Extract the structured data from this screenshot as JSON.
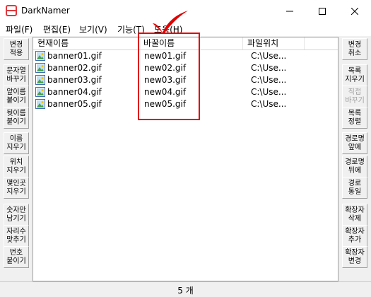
{
  "window": {
    "title": "DarkNamer"
  },
  "menu": [
    {
      "label": "파일(F)"
    },
    {
      "label": "편집(E)"
    },
    {
      "label": "보기(V)"
    },
    {
      "label": "기능(T)"
    },
    {
      "label": "도움(H)"
    }
  ],
  "list": {
    "columns": [
      "현재이름",
      "바꿀이름",
      "파일위치"
    ],
    "rows": [
      {
        "current": "banner01.gif",
        "new": "new01.gif",
        "location": "C:\\Use..."
      },
      {
        "current": "banner02.gif",
        "new": "new02.gif",
        "location": "C:\\Use..."
      },
      {
        "current": "banner03.gif",
        "new": "new03.gif",
        "location": "C:\\Use..."
      },
      {
        "current": "banner04.gif",
        "new": "new04.gif",
        "location": "C:\\Use..."
      },
      {
        "current": "banner05.gif",
        "new": "new05.gif",
        "location": "C:\\Use..."
      }
    ]
  },
  "left_toolbar": [
    {
      "label": "변경\n적용"
    },
    {
      "label": "문자열\n바꾸기"
    },
    {
      "label": "앞이름\n붙이기"
    },
    {
      "label": "뒷이름\n붙이기"
    },
    {
      "label": "이름\n지우기"
    },
    {
      "label": "위치\n지우기"
    },
    {
      "label": "몇인곳\n지우기"
    },
    {
      "label": "숫자만\n남기기"
    },
    {
      "label": "자리수\n맞추기"
    },
    {
      "label": "번호\n붙이기"
    }
  ],
  "right_toolbar": [
    {
      "label": "변경\n취소",
      "enabled": true
    },
    {
      "label": "목록\n지우기",
      "enabled": true
    },
    {
      "label": "직접\n바꾸기",
      "enabled": false
    },
    {
      "label": "목록\n정렬",
      "enabled": true
    },
    {
      "label": "경로명\n앞에",
      "enabled": true
    },
    {
      "label": "경로명\n뒤에",
      "enabled": true
    },
    {
      "label": "경로\n통일",
      "enabled": true
    },
    {
      "label": "확장자\n삭제",
      "enabled": true
    },
    {
      "label": "확장자\n추가",
      "enabled": true
    },
    {
      "label": "확장자\n변경",
      "enabled": true
    }
  ],
  "status": {
    "count": "5 개"
  },
  "colors": {
    "annotation": "#e00000",
    "icon_red": "#e0393e"
  }
}
